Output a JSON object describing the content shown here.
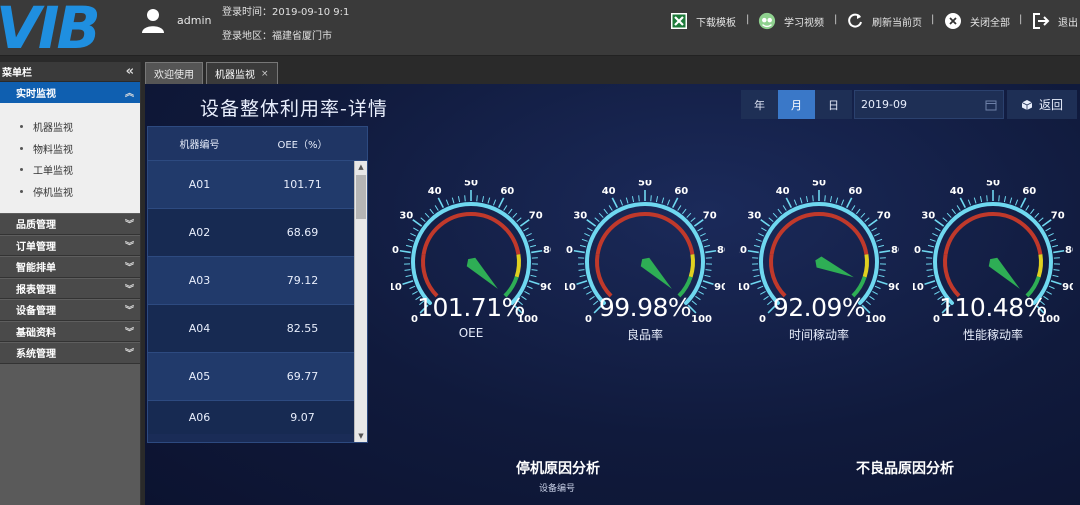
{
  "header": {
    "logo_text": "VIB",
    "user": "admin",
    "login_time": "登录时间：2019-09-10 9:1",
    "login_area": "登录地区：福建省厦门市",
    "buttons": [
      {
        "label": "下载模板",
        "icon": "excel-icon"
      },
      {
        "label": "学习视频",
        "icon": "video-icon"
      },
      {
        "label": "刷新当前页",
        "icon": "refresh-icon"
      },
      {
        "label": "关闭全部",
        "icon": "close-all-icon"
      },
      {
        "label": "退出",
        "icon": "logout-icon"
      }
    ],
    "separator": "|"
  },
  "sidebar": {
    "title": "菜单栏",
    "collapse_glyph": "«",
    "active_group": "实时监视",
    "sub_items": [
      "机器监视",
      "物料监视",
      "工单监视",
      "停机监视"
    ],
    "groups": [
      "品质管理",
      "订单管理",
      "智能排单",
      "报表管理",
      "设备管理",
      "基础资料",
      "系统管理"
    ]
  },
  "tabs": [
    {
      "label": "欢迎使用",
      "active": false
    },
    {
      "label": "机器监视",
      "active": true,
      "close": "×"
    }
  ],
  "main": {
    "title": "设备整体利用率-详情",
    "periods": [
      "年",
      "月",
      "日"
    ],
    "active_period": "月",
    "date_value": "2019-09",
    "back_label": "返回"
  },
  "table": {
    "headers": [
      "机器编号",
      "OEE（%）"
    ],
    "rows": [
      [
        "A01",
        "101.71"
      ],
      [
        "A02",
        "68.69"
      ],
      [
        "A03",
        "79.12"
      ],
      [
        "A04",
        "82.55"
      ],
      [
        "A05",
        "69.77"
      ],
      [
        "A06",
        "9.07"
      ]
    ]
  },
  "gauges": [
    {
      "value": 101.71,
      "display": "101.71%",
      "label": "OEE"
    },
    {
      "value": 99.98,
      "display": "99.98%",
      "label": "良品率"
    },
    {
      "value": 92.09,
      "display": "92.09%",
      "label": "时间稼动率"
    },
    {
      "value": 110.48,
      "display": "110.48%",
      "label": "性能稼动率"
    }
  ],
  "gauge_ticks": [
    "0",
    "10",
    "20",
    "30",
    "40",
    "50",
    "60",
    "70",
    "80",
    "90",
    "100"
  ],
  "analysis": {
    "stop_title": "停机原因分析",
    "stop_sub": "设备编号",
    "defect_title": "不良品原因分析"
  },
  "colors": {
    "accent_blue": "#3a78c8",
    "gauge_red": "#c0392b",
    "gauge_yellow": "#e0d020",
    "gauge_green": "#2eae55",
    "gauge_ring": "#6fd8f0"
  }
}
